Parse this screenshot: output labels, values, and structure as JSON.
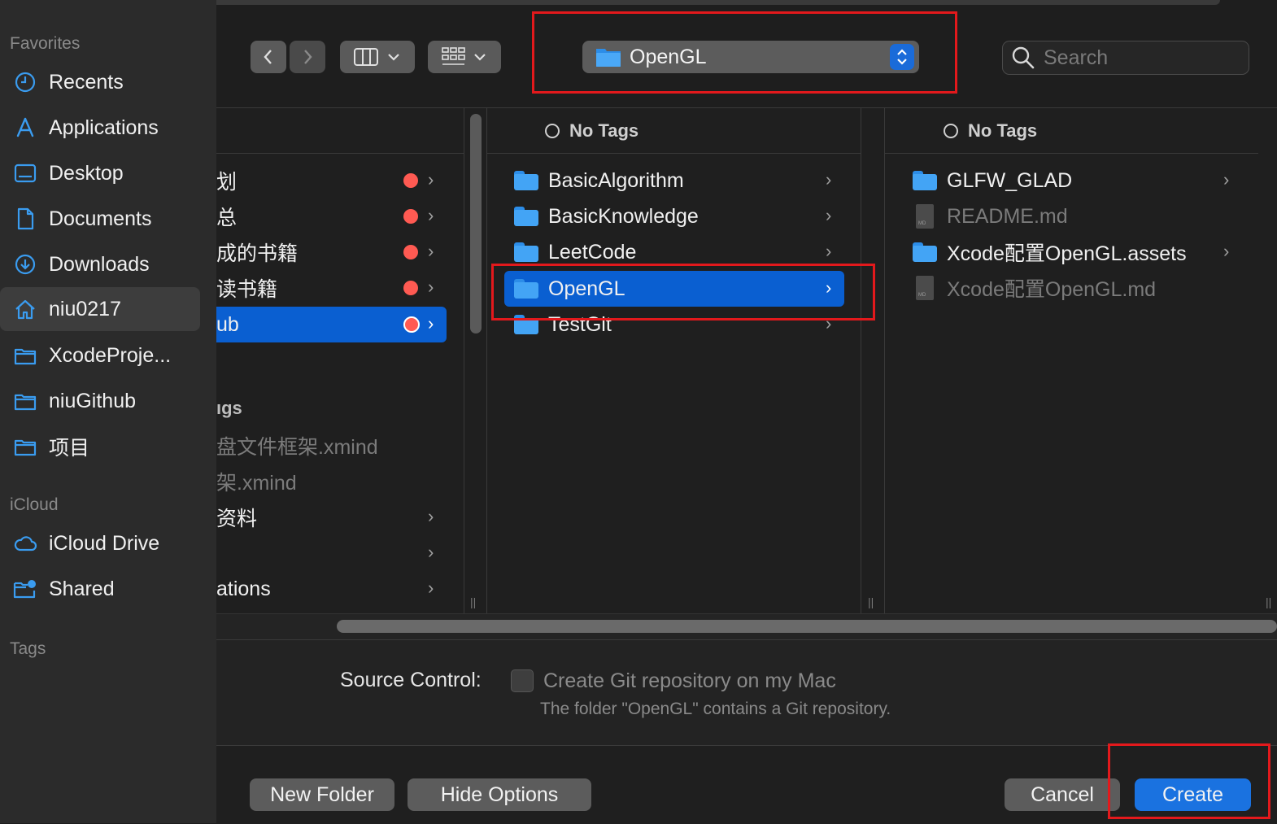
{
  "sidebar": {
    "favorites_label": "Favorites",
    "icloud_label": "iCloud",
    "tags_label": "Tags",
    "items": [
      {
        "label": "Recents",
        "icon": "clock-icon"
      },
      {
        "label": "Applications",
        "icon": "applications-icon"
      },
      {
        "label": "Desktop",
        "icon": "desktop-icon"
      },
      {
        "label": "Documents",
        "icon": "document-icon"
      },
      {
        "label": "Downloads",
        "icon": "download-icon"
      },
      {
        "label": "niu0217",
        "icon": "home-icon"
      },
      {
        "label": "XcodeProje...",
        "icon": "folder-icon"
      },
      {
        "label": "niuGithub",
        "icon": "folder-icon"
      },
      {
        "label": "项目",
        "icon": "folder-icon"
      }
    ],
    "icloud_items": [
      {
        "label": "iCloud Drive",
        "icon": "cloud-icon"
      },
      {
        "label": "Shared",
        "icon": "shared-folder-icon"
      }
    ]
  },
  "toolbar": {
    "path_label": "OpenGL",
    "search_placeholder": "Search"
  },
  "columns": {
    "col1": [
      {
        "label": "划",
        "dot": true,
        "chevron": true
      },
      {
        "label": "总",
        "dot": true,
        "chevron": true
      },
      {
        "label": "成的书籍",
        "dot": true,
        "chevron": true
      },
      {
        "label": "读书籍",
        "dot": true,
        "chevron": true
      },
      {
        "label": "ub",
        "dot": true,
        "chevron": true,
        "selected": true
      },
      {
        "label": "",
        "dot": false,
        "chevron": false
      },
      {
        "label": "ıgs",
        "dot": false,
        "chevron": false
      },
      {
        "label": "盘文件框架.xmind",
        "dot": false,
        "chevron": false,
        "dim": true
      },
      {
        "label": "架.xmind",
        "dot": false,
        "chevron": false,
        "dim": true
      },
      {
        "label": "资料",
        "dot": false,
        "chevron": true
      },
      {
        "label": "",
        "dot": false,
        "chevron": true
      },
      {
        "label": "ations",
        "dot": false,
        "chevron": true
      }
    ],
    "col2_header": "No Tags",
    "col2": [
      {
        "label": "BasicAlgorithm"
      },
      {
        "label": "BasicKnowledge"
      },
      {
        "label": "LeetCode"
      },
      {
        "label": "OpenGL",
        "selected": true
      },
      {
        "label": "TestGit"
      }
    ],
    "col3_header": "No Tags",
    "col3": [
      {
        "label": "GLFW_GLAD",
        "type": "folder"
      },
      {
        "label": "README.md",
        "type": "file"
      },
      {
        "label": "Xcode配置OpenGL.assets",
        "type": "folder"
      },
      {
        "label": "Xcode配置OpenGL.md",
        "type": "file"
      }
    ],
    "md_badge": "MD"
  },
  "options": {
    "source_control_label": "Source Control:",
    "checkbox_label": "Create Git repository on my Mac",
    "note": "The folder \"OpenGL\" contains a Git repository."
  },
  "footer": {
    "new_folder": "New Folder",
    "hide_options": "Hide Options",
    "cancel": "Cancel",
    "create": "Create"
  },
  "colors": {
    "accent": "#1a72e0",
    "selection": "#0a5fd1",
    "tag_red": "#ff5a52",
    "highlight_box": "#e3191c"
  }
}
